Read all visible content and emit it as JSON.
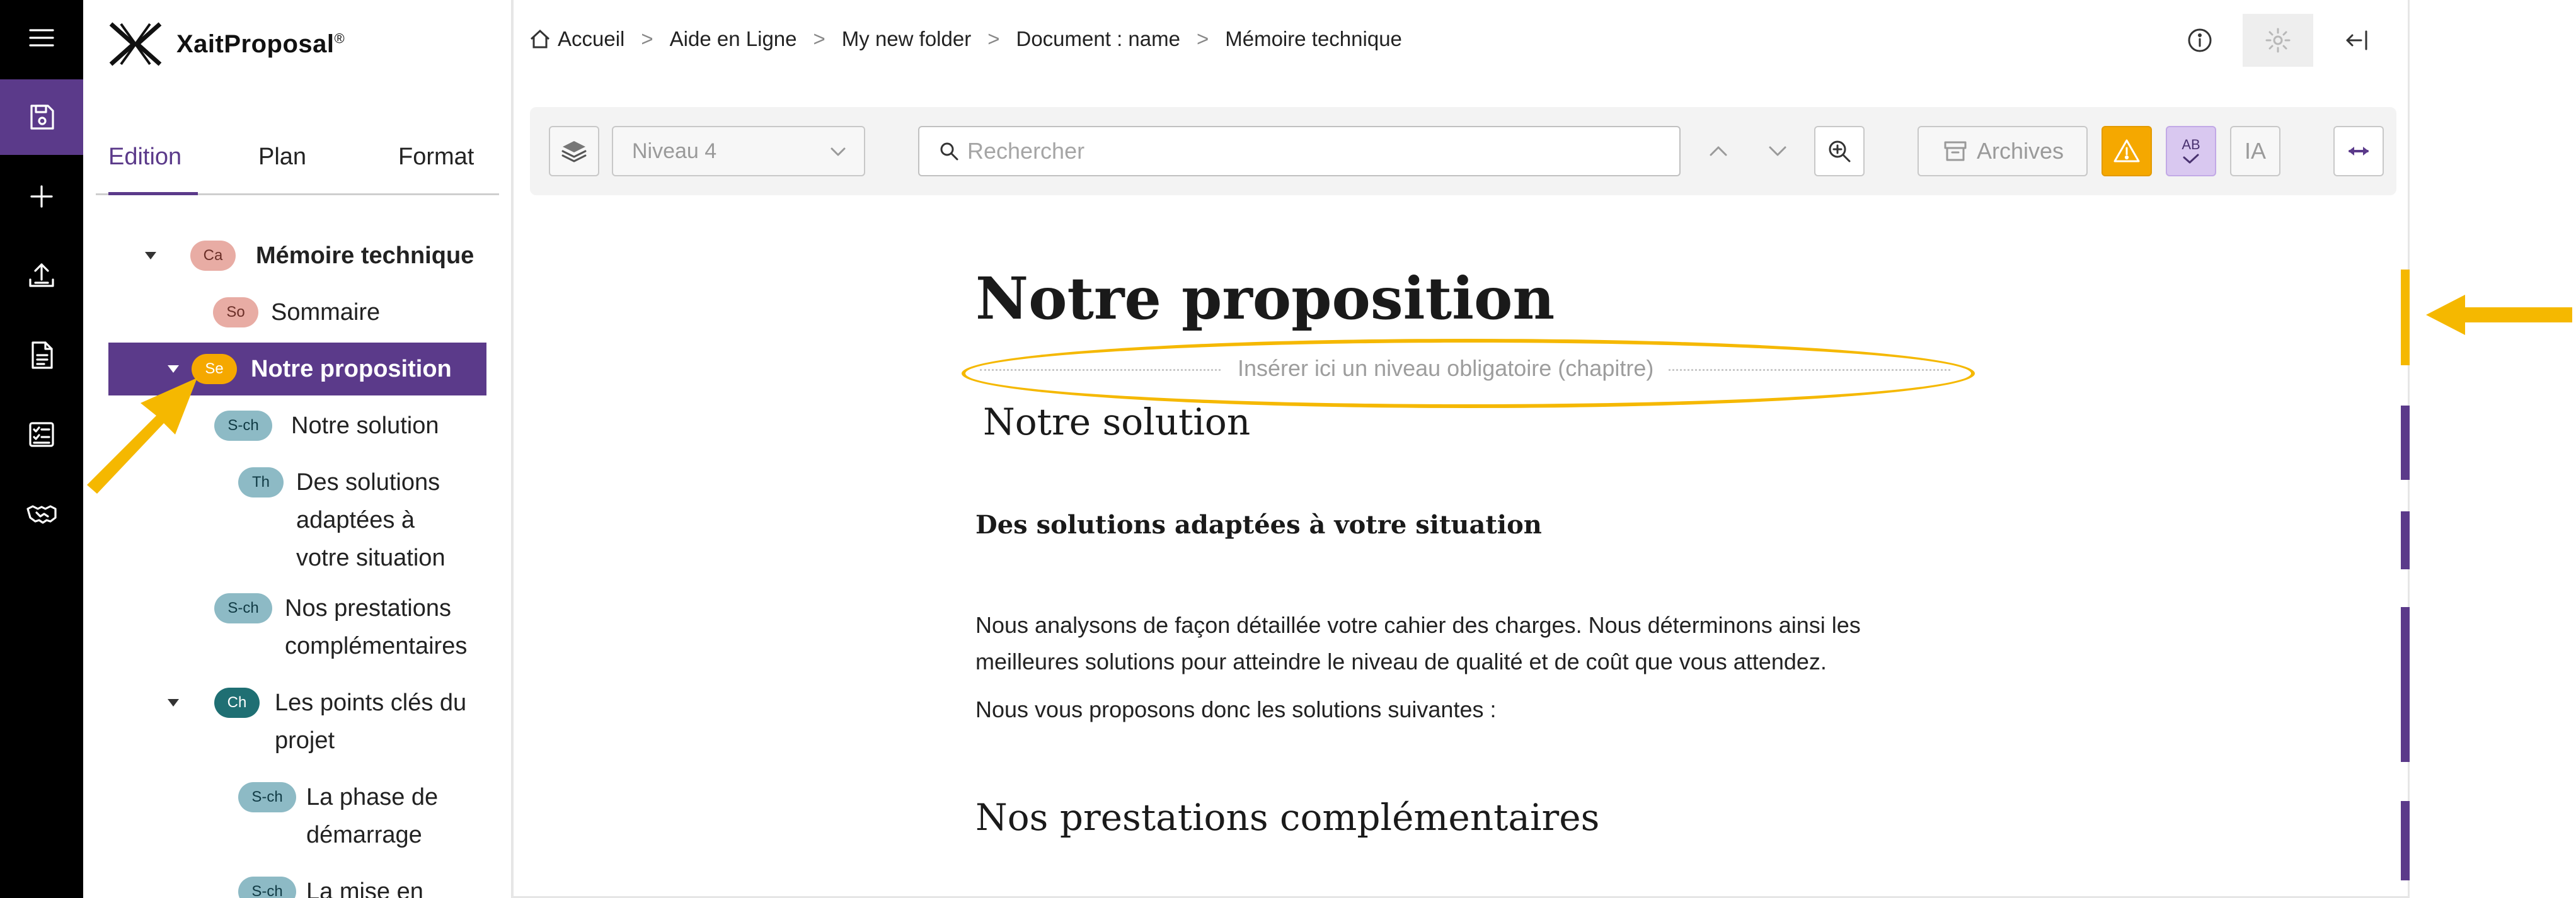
{
  "app": {
    "name": "XaitProposal",
    "trademark": "®"
  },
  "rail": {
    "items": [
      {
        "name": "menu-icon"
      },
      {
        "name": "save-icon"
      },
      {
        "name": "add-icon"
      },
      {
        "name": "upload-icon"
      },
      {
        "name": "document-icon"
      },
      {
        "name": "checklist-icon"
      },
      {
        "name": "handshake-icon"
      }
    ]
  },
  "tabs": [
    {
      "label": "Edition",
      "active": true
    },
    {
      "label": "Plan",
      "active": false
    },
    {
      "label": "Format",
      "active": false
    }
  ],
  "tree": [
    {
      "badge": "Ca",
      "label": "Mémoire technique",
      "expanded": true,
      "badge_color": "#e8aca4"
    },
    {
      "badge": "So",
      "label": "Sommaire",
      "badge_color": "#e8aca4"
    },
    {
      "badge": "Se",
      "label": "Notre proposition",
      "expanded": true,
      "selected": true,
      "badge_color": "#f5a800"
    },
    {
      "badge": "S-ch",
      "label": "Notre solution",
      "badge_color": "#8dbac5"
    },
    {
      "badge": "Th",
      "label": "Des solutions adaptées à votre situation",
      "badge_color": "#8dbac5"
    },
    {
      "badge": "S-ch",
      "label": "Nos prestations complémentaires",
      "badge_color": "#8dbac5"
    },
    {
      "badge": "Ch",
      "label": "Les points clés du projet",
      "expanded": true,
      "badge_color": "#1f6f73"
    },
    {
      "badge": "S-ch",
      "label": "La phase de démarrage",
      "badge_color": "#8dbac5"
    },
    {
      "badge": "S-ch",
      "label": "La mise en",
      "badge_color": "#8dbac5"
    }
  ],
  "breadcrumb": [
    "Accueil",
    "Aide en Ligne",
    "My new folder",
    "Document : name",
    "Mémoire technique"
  ],
  "breadcrumb_sep": ">",
  "top_icons": [
    "info-icon",
    "settings-icon",
    "collapse-panel-icon"
  ],
  "toolbar": {
    "level_select": "Niveau 4",
    "search_placeholder": "Rechercher",
    "archives_label": "Archives",
    "spellcheck_label": "AB",
    "ai_label": "IA"
  },
  "document": {
    "title": "Notre proposition",
    "insert_placeholder": "Insérer ici un niveau obligatoire (chapitre)",
    "section1": "Notre solution",
    "subsection": "Des solutions adaptées à votre situation",
    "paragraph1_line1": "Nous analysons de façon détaillée votre cahier des charges. Nous déterminons ainsi les",
    "paragraph1_line2": "meilleures solutions pour atteindre le niveau de qualité et de coût que vous attendez.",
    "paragraph2": "Nous vous proposons donc les solutions suivantes :",
    "section2": "Nos prestations complémentaires"
  },
  "colors": {
    "accent": "#5b3a8a",
    "highlight": "#f5b800",
    "warning": "#f5a800"
  }
}
